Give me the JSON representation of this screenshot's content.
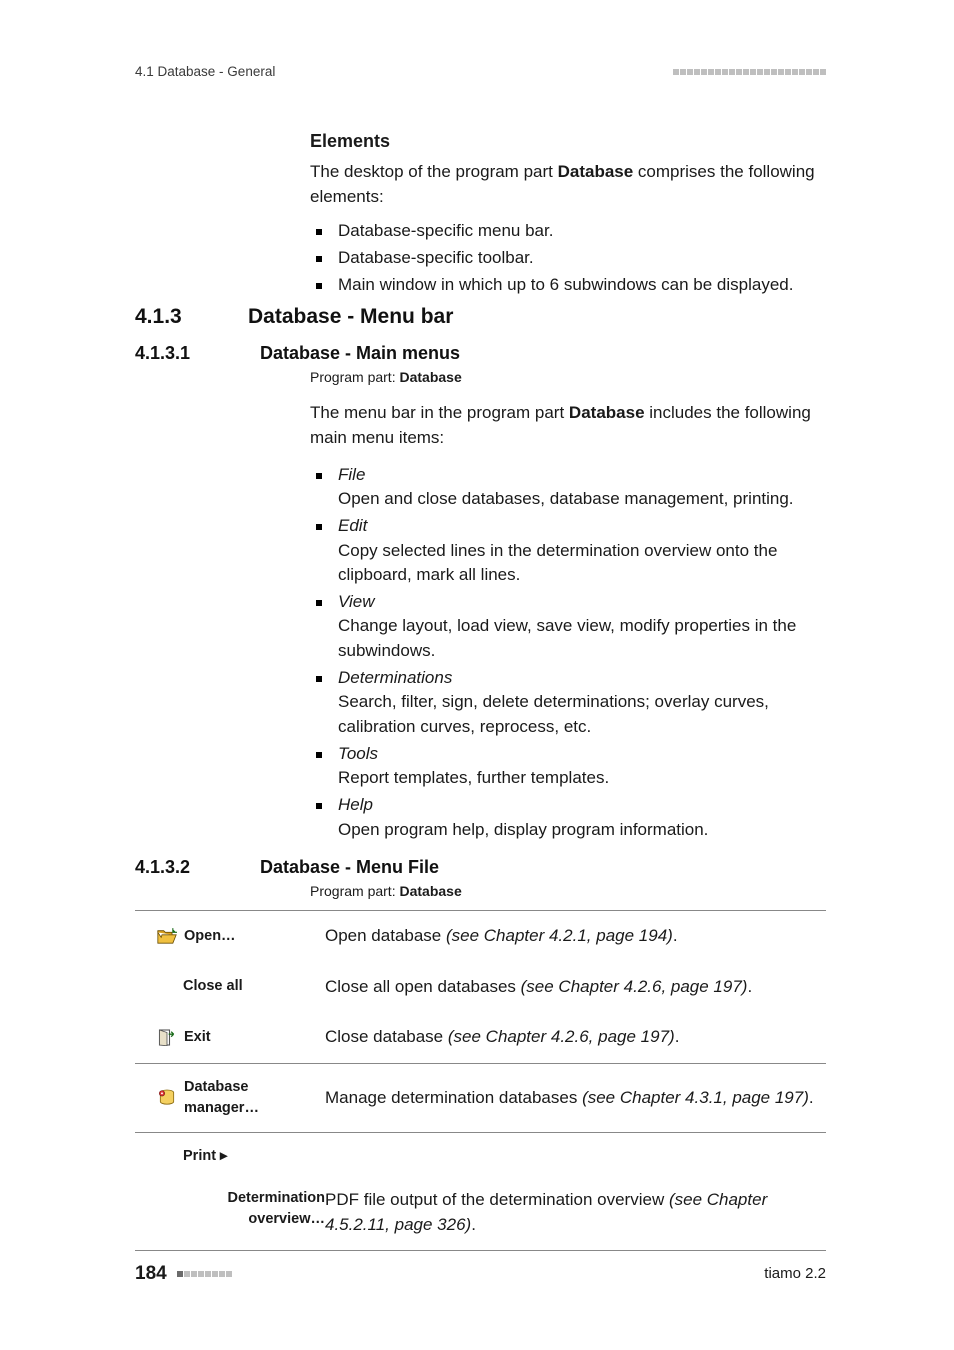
{
  "header": {
    "left": "4.1 Database - General"
  },
  "elements_block": {
    "heading": "Elements",
    "intro_pre": "The desktop of the program part ",
    "intro_strong": "Database",
    "intro_post": " comprises the following elements:",
    "bullets": [
      "Database-specific menu bar.",
      "Database-specific toolbar.",
      "Main window in which up to 6 subwindows can be displayed."
    ]
  },
  "h3": {
    "num": "4.1.3",
    "title": "Database - Menu bar"
  },
  "h4a": {
    "num": "4.1.3.1",
    "title": "Database - Main menus"
  },
  "program_part": {
    "label": "Program part: ",
    "value": "Database"
  },
  "main_menus": {
    "intro_pre": "The menu bar in the program part ",
    "intro_strong": "Database",
    "intro_post": " includes the following main menu items:",
    "items": [
      {
        "name": "File",
        "desc": "Open and close databases, database management, printing."
      },
      {
        "name": "Edit",
        "desc": "Copy selected lines in the determination overview onto the clipboard, mark all lines."
      },
      {
        "name": "View",
        "desc": "Change layout, load view, save view, modify properties in the subwindows."
      },
      {
        "name": "Determinations",
        "desc": "Search, filter, sign, delete determinations; overlay curves, calibration curves, reprocess, etc."
      },
      {
        "name": "Tools",
        "desc": "Report templates, further templates."
      },
      {
        "name": "Help",
        "desc": "Open program help, display program information."
      }
    ]
  },
  "h4b": {
    "num": "4.1.3.2",
    "title": "Database - Menu File"
  },
  "file_menu": {
    "rows": [
      {
        "icon": "open-folder-icon",
        "label": "Open…",
        "desc": "Open database ",
        "ref": "(see Chapter 4.2.1, page 194)",
        "tail": "."
      },
      {
        "icon": "",
        "label": "Close all",
        "desc": "Close all open databases ",
        "ref": "(see Chapter 4.2.6, page 197)",
        "tail": "."
      },
      {
        "icon": "exit-door-icon",
        "label": "Exit",
        "desc": "Close database ",
        "ref": "(see Chapter 4.2.6, page 197)",
        "tail": "."
      },
      {
        "icon": "db-manager-icon",
        "label": "Database manager…",
        "desc": "Manage determination databases ",
        "ref": "(see Chapter 4.3.1, page 197)",
        "tail": "."
      },
      {
        "icon": "",
        "label": "Print ▸",
        "desc": "",
        "ref": "",
        "tail": ""
      },
      {
        "icon": "",
        "label_sub1": "Determination",
        "label_sub2": "overview…",
        "desc": "PDF file output of the determination overview ",
        "ref": "(see Chapter 4.5.2.11, page 326)",
        "tail": "."
      }
    ]
  },
  "footer": {
    "page": "184",
    "right": "tiamo 2.2"
  }
}
